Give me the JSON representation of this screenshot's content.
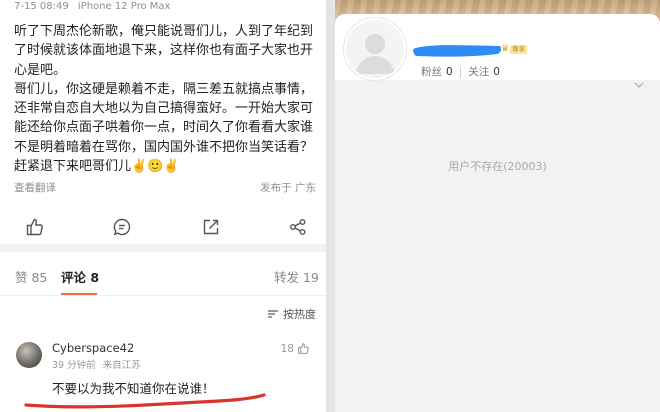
{
  "post": {
    "date": "7-15 08:49",
    "device": "iPhone 12 Pro Max",
    "text": "听了下周杰伦新歌，俺只能说哥们儿，人到了年纪到了时候就该体面地退下来，这样你也有面子大家也开心是吧。\n哥们儿，你这硬是赖着不走，隔三差五就搞点事情，还非常自恋自大地以为自己搞得蛮好。一开始大家可能还给你点面子哄着你一点，时间久了你看看大家谁不是明着暗着在骂你，国内国外谁不把你当笑话看？赶紧退下来吧哥们儿✌️🙂✌️",
    "translate_label": "查看翻译",
    "location_label": "发布于 广东"
  },
  "actions": {
    "icons": [
      "thumbs-up-icon",
      "comment-icon",
      "share-icon",
      "more-share-icon"
    ]
  },
  "tabs": [
    {
      "label": "赞 85"
    },
    {
      "label": "评论 8"
    },
    {
      "label": "转发 19"
    }
  ],
  "sort_label": "按热度",
  "comment": {
    "username": "Cyberspace42",
    "time": "39 分钟前",
    "location": "来自江苏",
    "likes": "18",
    "text": "不要以为我不知道你在说谁！"
  },
  "profile": {
    "vip_tag": "尊享",
    "followers_label": "粉丝",
    "followers": "0",
    "following_label": "关注",
    "following": "0",
    "empty_message": "用户不存在(20003)"
  },
  "colors": {
    "accent": "#f06a3a",
    "red_mark": "#d9342b",
    "blue_mark": "#2f8cf5"
  }
}
